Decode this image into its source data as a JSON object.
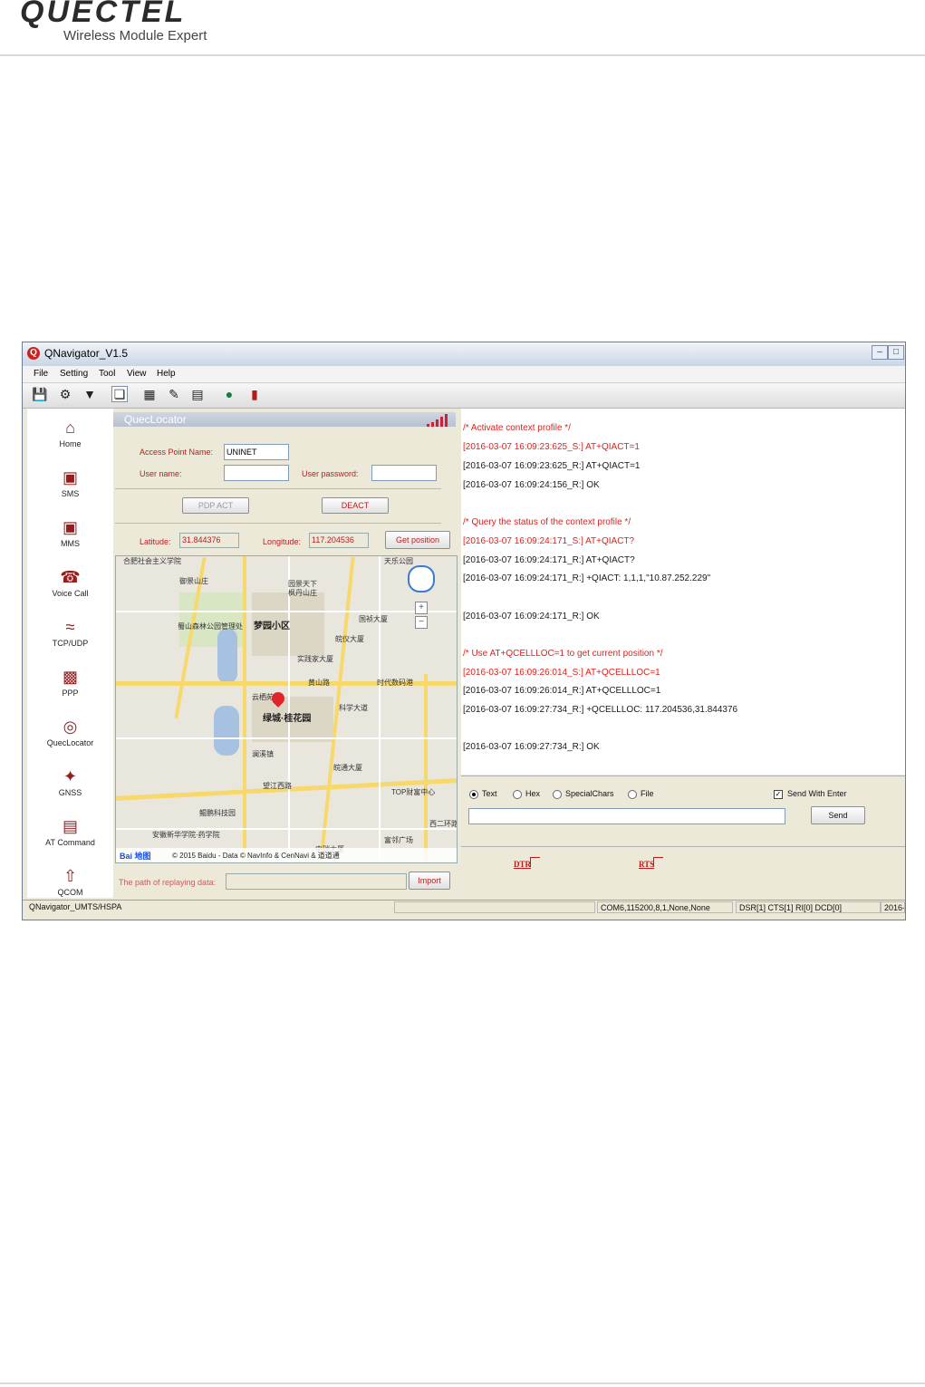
{
  "doc": {
    "brand": "QUECTEL",
    "tagline": "Wireless Module Expert"
  },
  "window": {
    "title": "QNavigator_V1.5"
  },
  "menu": [
    "File",
    "Setting",
    "Tool",
    "View",
    "Help"
  ],
  "toolbar_icons": [
    "save-icon",
    "settings-icon",
    "filter-icon",
    "new-page-icon",
    "grid-icon",
    "broom-icon",
    "notes-icon",
    "globe-icon",
    "module-icon"
  ],
  "nav": [
    {
      "label": "Home",
      "icon": "home-icon"
    },
    {
      "label": "SMS",
      "icon": "sms-icon"
    },
    {
      "label": "MMS",
      "icon": "mms-icon"
    },
    {
      "label": "Voice Call",
      "icon": "phone-icon"
    },
    {
      "label": "TCP/UDP",
      "icon": "wifi-icon"
    },
    {
      "label": "PPP",
      "icon": "chat-icon"
    },
    {
      "label": "QuecLocator",
      "icon": "globe-icon"
    },
    {
      "label": "GNSS",
      "icon": "satellite-icon"
    },
    {
      "label": "AT Command",
      "icon": "document-icon"
    },
    {
      "label": "QCOM",
      "icon": "upload-icon"
    }
  ],
  "locator": {
    "title": "QuecLocator",
    "apn_label": "Access Point Name:",
    "apn_value": "UNINET",
    "user_label": "User name:",
    "user_value": "",
    "password_label": "User password:",
    "password_value": "",
    "pdp_act": "PDP ACT",
    "deact": "DEACT",
    "lat_label": "Latitude:",
    "lat_value": "31.844376",
    "lon_label": "Longitude:",
    "lon_value": "117.204536",
    "get_position": "Get position",
    "replay_label": "The path of replaying data:",
    "replay_value": "",
    "import": "Import"
  },
  "map": {
    "labels": [
      "合肥社会主义学院",
      "御景山庄",
      "天乐公园",
      "园景天下",
      "枫丹山庄",
      "蜀山森林公园管理处",
      "梦园小区",
      "国祯大厦",
      "皖仪大厦",
      "实践家大厦",
      "黄山路",
      "时代数码港",
      "云栖苑",
      "绿城·桂花园",
      "澜溪镇",
      "皖通大厦",
      "望江西路",
      "TOP财富中心",
      "鲲鹏科技园",
      "安徽新华学院·药学院",
      "富邻广场",
      "中瑞大厦",
      "科学大道",
      "西二环路"
    ],
    "copyright": "© 2015 Baidu - Data © NavInfo & CenNavi & 道道通",
    "brand": "Bai 地图"
  },
  "log": [
    {
      "text": "/* Activate context profile */",
      "color": "red"
    },
    {
      "text": "[2016-03-07 16:09:23:625_S:] AT+QIACT=1",
      "color": "red"
    },
    {
      "text": "[2016-03-07 16:09:23:625_R:] AT+QIACT=1",
      "color": "black"
    },
    {
      "text": "[2016-03-07 16:09:24:156_R:] OK",
      "color": "black"
    },
    {
      "text": "/* Query the status of the context profile */",
      "color": "red"
    },
    {
      "text": "[2016-03-07 16:09:24:171_S:] AT+QIACT?",
      "color": "red"
    },
    {
      "text": "[2016-03-07 16:09:24:171_R:] AT+QIACT?",
      "color": "black"
    },
    {
      "text": "[2016-03-07 16:09:24:171_R:] +QIACT: 1,1,1,\"10.87.252.229\"",
      "color": "black"
    },
    {
      "text": "[2016-03-07 16:09:24:171_R:] OK",
      "color": "black"
    },
    {
      "text": "/* Use AT+QCELLLOC=1 to get current position */",
      "color": "red"
    },
    {
      "text": "[2016-03-07 16:09:26:014_S:] AT+QCELLLOC=1",
      "color": "red"
    },
    {
      "text": "[2016-03-07 16:09:26:014_R:] AT+QCELLLOC=1",
      "color": "black"
    },
    {
      "text": "[2016-03-07 16:09:27:734_R:] +QCELLLOC: 117.204536,31.844376",
      "color": "black"
    },
    {
      "text": "[2016-03-07 16:09:27:734_R:] OK",
      "color": "black"
    }
  ],
  "send": {
    "modes": [
      "Text",
      "Hex",
      "SpecialChars",
      "File"
    ],
    "selected_mode": "Text",
    "send_with_enter": "Send With Enter",
    "send_with_enter_checked": true,
    "input_value": "",
    "send_button": "Send"
  },
  "lines": {
    "dtr": "DTR",
    "rts": "RTS"
  },
  "status": {
    "product": "QNavigator_UMTS/HSPA",
    "blank": "",
    "port": "COM6,115200,8,1,None,None",
    "signals": "DSR[1] CTS[1] RI[0] DCD[0]",
    "date": "2016-"
  }
}
